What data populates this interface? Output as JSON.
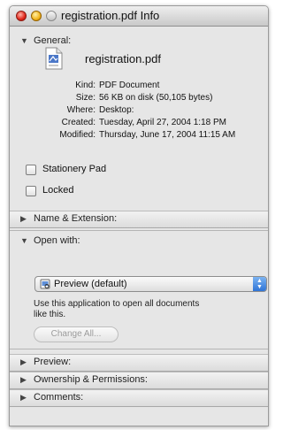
{
  "window": {
    "title": "registration.pdf Info"
  },
  "icons": {
    "close": "close-button-icon",
    "minimize": "minimize-button-icon",
    "zoom": "zoom-button-icon",
    "file": "pdf-file-icon",
    "app": "preview-app-icon",
    "expanded": "disclosure-triangle-down-icon",
    "collapsed": "disclosure-triangle-right-icon"
  },
  "general": {
    "title": "General:",
    "filename": "registration.pdf",
    "kind": {
      "label": "Kind:",
      "value": "PDF Document"
    },
    "size": {
      "label": "Size:",
      "value": "56 KB on disk (50,105 bytes)"
    },
    "where": {
      "label": "Where:",
      "value": "Desktop:"
    },
    "created": {
      "label": "Created:",
      "value": "Tuesday, April 27, 2004 1:18 PM"
    },
    "modified": {
      "label": "Modified:",
      "value": "Thursday, June 17, 2004 11:15 AM"
    },
    "stationery": {
      "label": "Stationery Pad",
      "checked": false
    },
    "locked": {
      "label": "Locked",
      "checked": false
    }
  },
  "name_extension": {
    "title": "Name & Extension:"
  },
  "open_with": {
    "title": "Open with:",
    "selected_app": "Preview (default)",
    "description": "Use this application to open all documents like this.",
    "change_all_label": "Change All..."
  },
  "preview": {
    "title": "Preview:"
  },
  "ownership": {
    "title": "Ownership & Permissions:"
  },
  "comments": {
    "title": "Comments:"
  }
}
